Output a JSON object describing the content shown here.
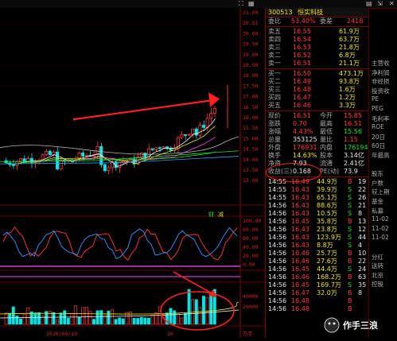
{
  "colors": {
    "up": "#ff3b3b",
    "down": "#22dd22",
    "bg": "#000000",
    "grid": "#5a0000",
    "accent": "#f2e600"
  },
  "topbar": {
    "icons": [
      "fullscreen-icon",
      "grid-icon",
      "chart-icon",
      "close-icon",
      "arrow-icon"
    ]
  },
  "chart": {
    "price_axis": [
      "21.00",
      "20.51",
      "20.00",
      "19.50",
      "19.00",
      "18.50",
      "18.00",
      "17.50",
      "17.00",
      "16.50",
      "16.00",
      "15.50",
      "15.00",
      "14.50",
      "14.00",
      "13.50",
      "13.00"
    ],
    "indicator_axis": [
      "100.00",
      "80.00",
      "60.00",
      "40.00",
      "20.00",
      "0.00"
    ],
    "volume_axis": [
      "40000",
      "20000"
    ],
    "date_label": "2020/09/10",
    "month_label": "10",
    "markers": [
      "财",
      "减"
    ],
    "axis_tail": "万手"
  },
  "quote": {
    "code": "300513",
    "name": "恒实科技",
    "weibi_label": "委比",
    "weibi_value": "53.40%",
    "weicha_label": "委差",
    "weicha_value": "2418",
    "sells": [
      {
        "label": "卖五",
        "price": "16.55",
        "vol": "61.9万"
      },
      {
        "label": "卖四",
        "price": "16.54",
        "vol": "63.7万"
      },
      {
        "label": "卖三",
        "price": "16.53",
        "vol": "21.8万"
      },
      {
        "label": "卖二",
        "price": "16.52",
        "vol": "6.8万"
      },
      {
        "label": "卖一",
        "price": "16.51",
        "vol": "21.1万"
      }
    ],
    "buys": [
      {
        "label": "买一",
        "price": "16.50",
        "vol": "473.1万"
      },
      {
        "label": "买二",
        "price": "16.49",
        "vol": "93.8万"
      },
      {
        "label": "买三",
        "price": "16.48",
        "vol": "1.6万"
      },
      {
        "label": "买四",
        "price": "16.47",
        "vol": "1.2万"
      },
      {
        "label": "买五",
        "price": "16.46",
        "vol": "3.3万"
      }
    ],
    "stats": [
      {
        "l1": "现价",
        "v1": "16.51",
        "c1": "red",
        "l2": "今开",
        "v2": "15.85",
        "c2": "red"
      },
      {
        "l1": "涨跌",
        "v1": "0.70",
        "c1": "red",
        "l2": "最高",
        "v2": "16.51",
        "c2": "red"
      },
      {
        "l1": "涨幅",
        "v1": "4.43%",
        "c1": "red",
        "l2": "最低",
        "v2": "15.56",
        "c2": "green"
      },
      {
        "l1": "总量",
        "v1": "353125",
        "c1": "white",
        "l2": "量比",
        "v2": "1.15",
        "c2": "red"
      },
      {
        "l1": "外盘",
        "v1": "176931",
        "c1": "red",
        "l2": "内盘",
        "v2": "176194",
        "c2": "green"
      },
      {
        "l1": "换手",
        "v1": "14.63%",
        "c1": "yellow",
        "l2": "股本",
        "v2": "3.14亿",
        "c2": "white"
      },
      {
        "l1": "净资",
        "v1": "7.93",
        "c1": "white",
        "l2": "流通",
        "v2": "2.41亿",
        "c2": "white"
      },
      {
        "l1": "收益(三)",
        "v1": "0.168",
        "c1": "white",
        "l2": "PE(动)",
        "v2": "73.9",
        "c2": "white"
      }
    ],
    "ticks": [
      {
        "t": "14:55",
        "p": "16.49",
        "v": "44.9万",
        "s": "B",
        "n": "19"
      },
      {
        "t": "14:55",
        "p": "16.43",
        "v": "39.9万",
        "s": "S",
        "n": "22"
      },
      {
        "t": "14:55",
        "p": "16.43",
        "v": "65.1万",
        "s": "S",
        "n": "26"
      },
      {
        "t": "14:56",
        "p": "16.43",
        "v": "88.6万",
        "s": "S",
        "n": "21"
      },
      {
        "t": "14:56",
        "p": "16.43",
        "v": "10.5万",
        "s": "S",
        "n": "8"
      },
      {
        "t": "14:56",
        "p": "16.45",
        "v": "35.8万",
        "s": "B",
        "n": "13"
      },
      {
        "t": "14:56",
        "p": "16.43",
        "v": "23.8万",
        "s": "S",
        "n": "12"
      },
      {
        "t": "14:56",
        "p": "16.43",
        "v": "123.9万",
        "s": "S",
        "n": "44"
      },
      {
        "t": "14:56",
        "p": "16.43",
        "v": "8.8万",
        "s": "S",
        "n": "4"
      },
      {
        "t": "14:56",
        "p": "16.46",
        "v": "25.7万",
        "s": "B",
        "n": "10"
      },
      {
        "t": "14:56",
        "p": "16.46",
        "v": "27.6万",
        "s": "B",
        "n": "22"
      },
      {
        "t": "14:56",
        "p": "16.45",
        "v": "44.4万",
        "s": "S",
        "n": "24"
      },
      {
        "t": "14:56",
        "p": "16.46",
        "v": "168.2万",
        "s": "B",
        "n": "63"
      },
      {
        "t": "14:56",
        "p": "16.45",
        "v": "169.7万",
        "s": "S",
        "n": "35"
      },
      {
        "t": "14:56",
        "p": "16.47",
        "v": "32.0万",
        "s": "B",
        "n": "8"
      },
      {
        "t": "14:56",
        "p": "16.48",
        "v": "",
        "s": "B",
        "n": ""
      },
      {
        "t": "14:56",
        "p": "16.48",
        "v": "",
        "s": "B",
        "n": ""
      }
    ]
  },
  "side": {
    "items": [
      "主营收",
      "净利润",
      "非经损",
      "投资收",
      "PE",
      "PEG",
      "毛利率",
      "ROE",
      "20日",
      "60日",
      "年最高",
      "",
      "股东",
      "户数",
      "较上期",
      "基金",
      "私募",
      "11-02",
      "11-02",
      "11-02",
      "",
      "分红",
      "送转",
      "北京",
      "控股"
    ]
  },
  "watermark": {
    "text": "作手三浪"
  }
}
